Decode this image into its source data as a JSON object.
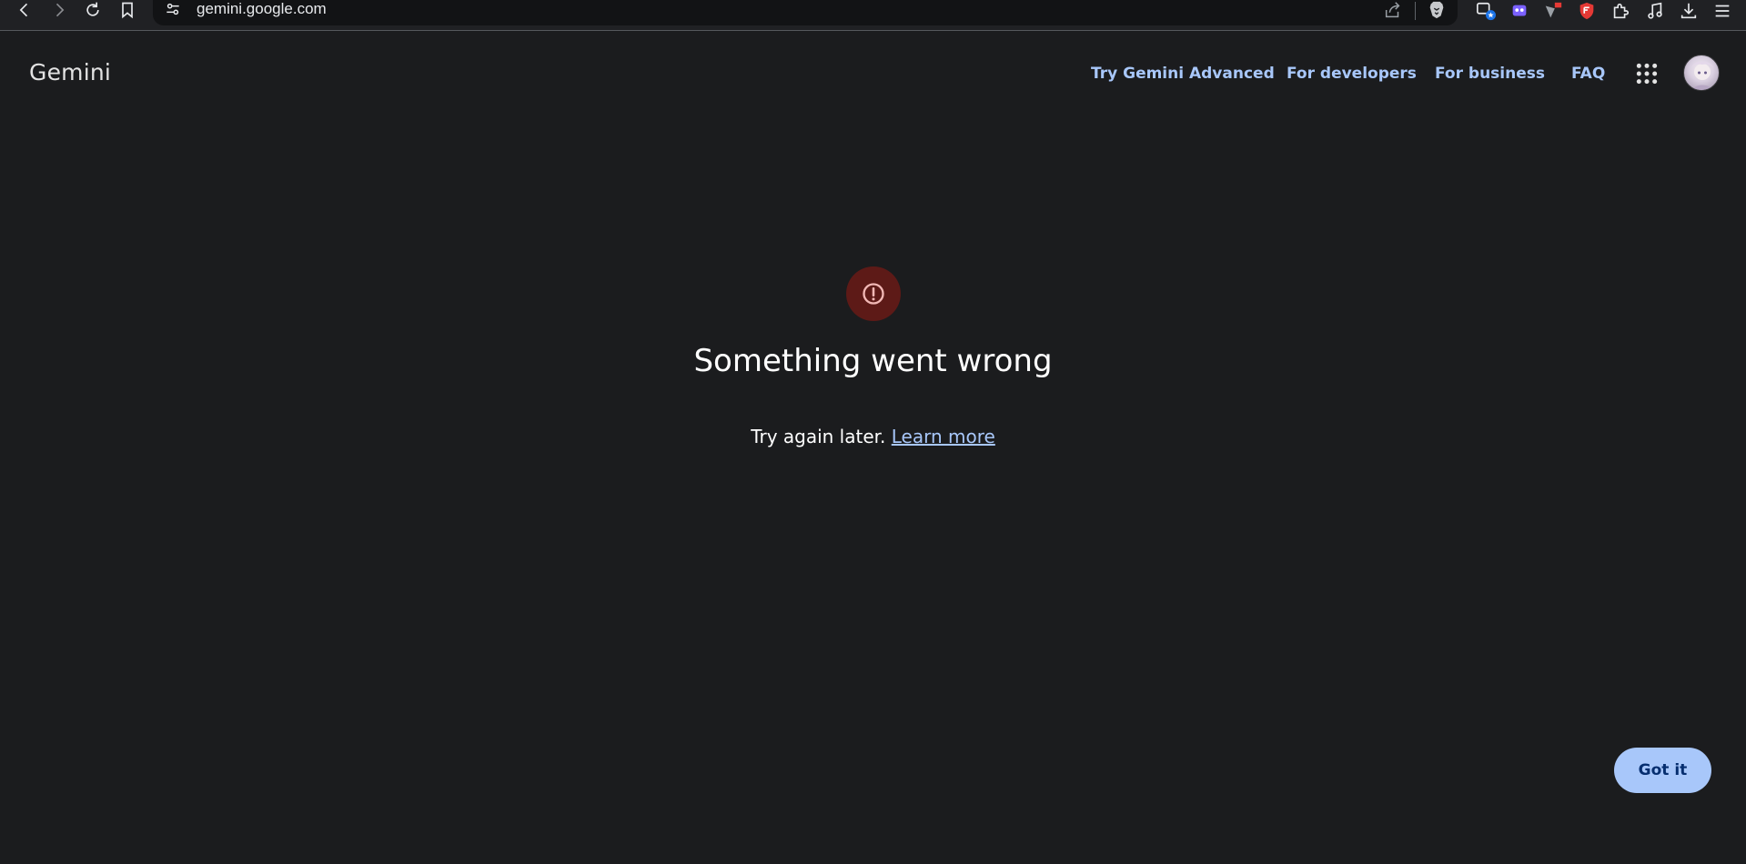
{
  "browser": {
    "url": "gemini.google.com"
  },
  "header": {
    "logo": "Gemini",
    "nav": [
      {
        "label": "Try Gemini Advanced"
      },
      {
        "label": "For developers"
      },
      {
        "label": "For business"
      },
      {
        "label": "FAQ"
      }
    ]
  },
  "error": {
    "icon": "error-alert-icon",
    "title": "Something went wrong",
    "message": "Try again later.",
    "link_label": "Learn more"
  },
  "dialog": {
    "got_it_label": "Got it"
  },
  "colors": {
    "background": "#1b1c1e",
    "link": "#a8c7fa",
    "error_circle": "#5d1a17",
    "button_bg": "#a8c7fa",
    "button_text": "#062e6f"
  }
}
